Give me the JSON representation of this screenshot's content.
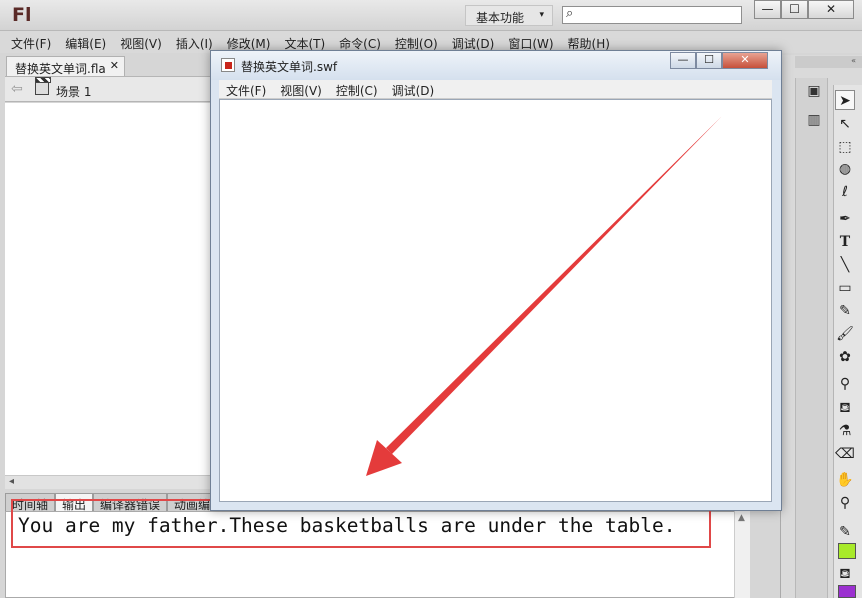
{
  "app": {
    "logo": "Fl",
    "workspace_label": "基本功能",
    "workspace_arrow": "▾"
  },
  "search": {
    "placeholder": ""
  },
  "window_controls": {
    "minimize": "—",
    "maximize": "☐",
    "close": "✕"
  },
  "menu": [
    "文件(F)",
    "编辑(E)",
    "视图(V)",
    "插入(I)",
    "修改(M)",
    "文本(T)",
    "命令(C)",
    "控制(O)",
    "调试(D)",
    "窗口(W)",
    "帮助(H)"
  ],
  "document_tab": {
    "label": "替换英文单词.fla",
    "close": "✕"
  },
  "scene": {
    "label": "场景 1"
  },
  "bottom_tabs": [
    "时间轴",
    "输出",
    "编译器错误",
    "动画编"
  ],
  "output": {
    "text": "You are my father.These basketballs are under the table."
  },
  "swf_window": {
    "title": "替换英文单词.swf",
    "menu": [
      "文件(F)",
      "视图(V)",
      "控制(C)",
      "调试(D)"
    ],
    "controls": {
      "minimize": "—",
      "maximize": "☐",
      "close": "✕"
    }
  },
  "dock": {
    "header_glyph": "«"
  },
  "tool_icons": [
    "selection-tool-icon",
    "subselection-tool-icon",
    "free-transform-tool-icon",
    "3d-rotation-tool-icon",
    "lasso-tool-icon",
    "pen-tool-icon",
    "text-tool-icon",
    "line-tool-icon",
    "rectangle-tool-icon",
    "pencil-tool-icon",
    "brush-tool-icon",
    "deco-tool-icon",
    "bone-tool-icon",
    "paint-bucket-tool-icon",
    "eyedropper-tool-icon",
    "eraser-tool-icon",
    "hand-tool-icon",
    "zoom-tool-icon"
  ],
  "colors": {
    "stroke_swatch": "#a8ea2a",
    "fill_swatch": "#9b30d0",
    "annotation": "#e04848"
  }
}
